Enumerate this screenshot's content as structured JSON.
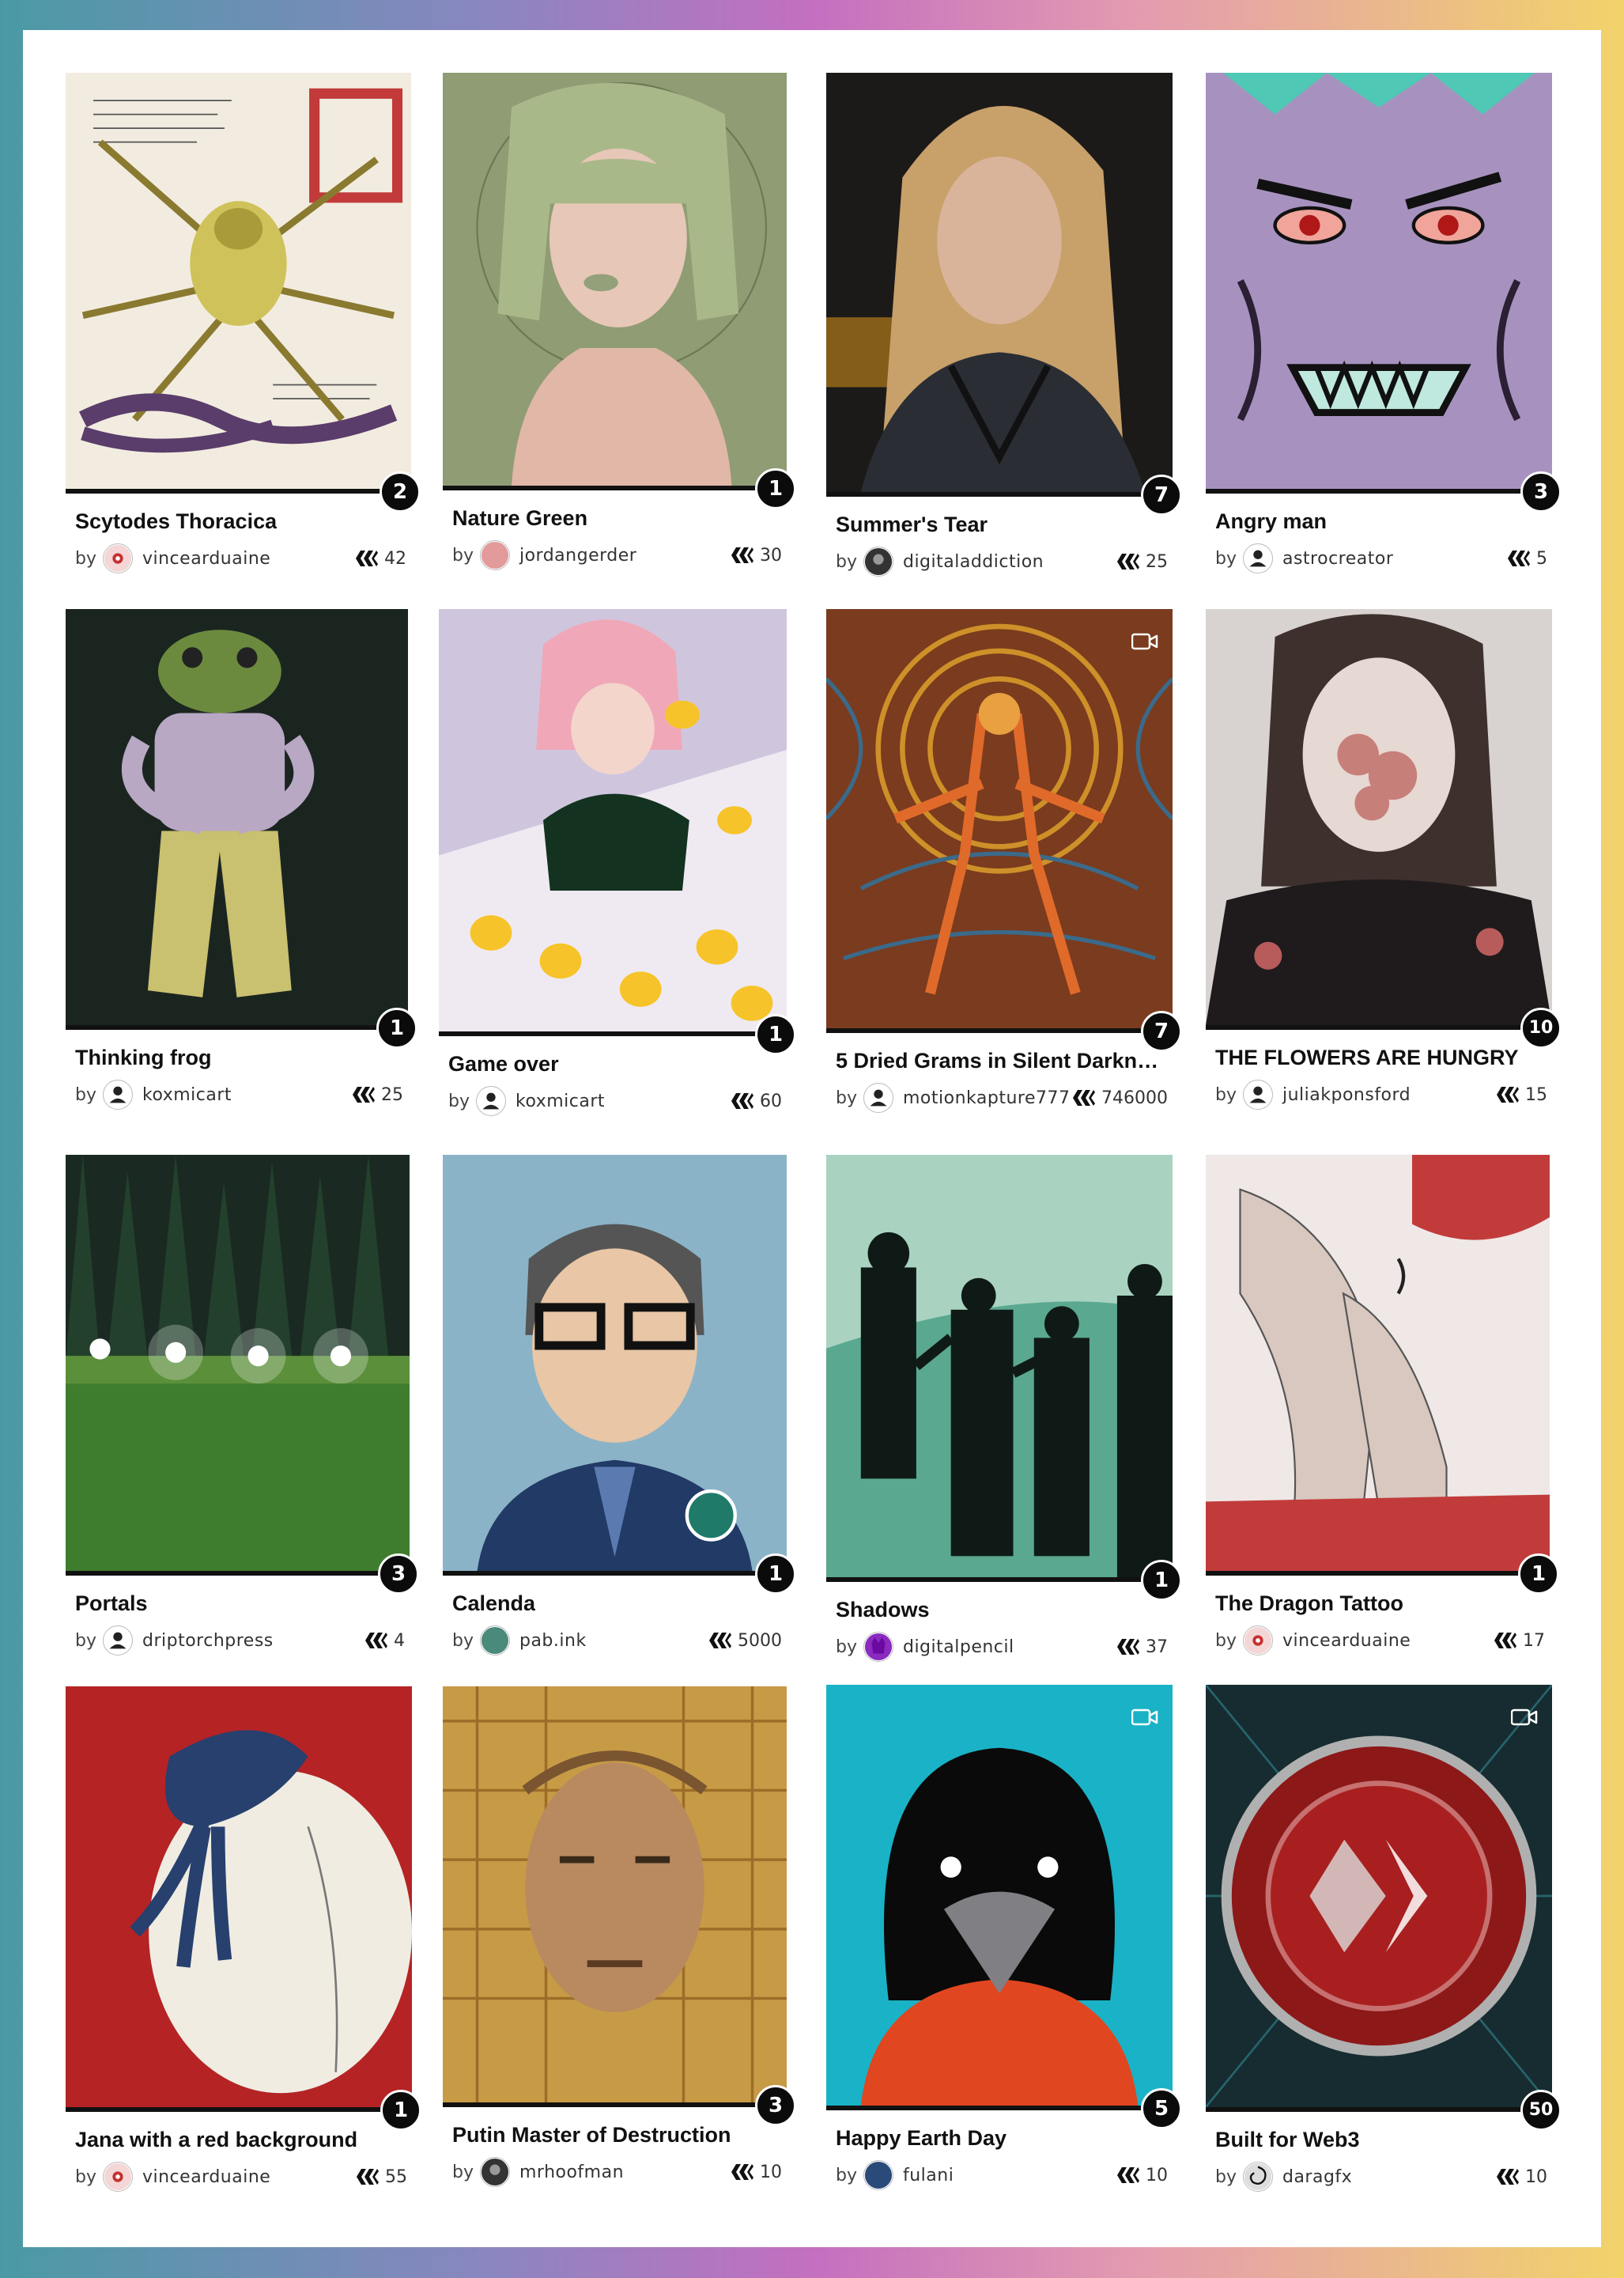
{
  "colors": {
    "accent_border": "#111111",
    "badge_bg": "#0b0b0b"
  },
  "cards": [
    {
      "title": "Scytodes Thoracica",
      "by": "by",
      "author": "vincearduaine",
      "avatar": "seal-avatar",
      "badge": "2",
      "count": "42",
      "video": false
    },
    {
      "title": "Nature Green",
      "by": "by",
      "author": "jordangerder",
      "avatar": "pink-avatar",
      "badge": "1",
      "count": "30",
      "video": false
    },
    {
      "title": "Summer's Tear",
      "by": "by",
      "author": "digitaladdiction",
      "avatar": "dark-avatar",
      "badge": "7",
      "count": "25",
      "video": false
    },
    {
      "title": "Angry man",
      "by": "by",
      "author": "astrocreator",
      "avatar": "default-user-icon",
      "badge": "3",
      "count": "5",
      "video": false
    },
    {
      "title": "Thinking frog",
      "by": "by",
      "author": "koxmicart",
      "avatar": "default-user-icon",
      "badge": "1",
      "count": "25",
      "video": false
    },
    {
      "title": "Game over",
      "by": "by",
      "author": "koxmicart",
      "avatar": "default-user-icon",
      "badge": "1",
      "count": "60",
      "video": false
    },
    {
      "title": "5 Dried Grams in Silent Darkne…",
      "by": "by",
      "author": "motionkapture777",
      "avatar": "default-user-icon",
      "badge": "7",
      "count": "746000",
      "video": true
    },
    {
      "title": "THE FLOWERS ARE HUNGRY",
      "by": "by",
      "author": "juliakponsford",
      "avatar": "default-user-icon",
      "badge": "10",
      "count": "15",
      "video": false
    },
    {
      "title": "Portals",
      "by": "by",
      "author": "driptorchpress",
      "avatar": "default-user-icon",
      "badge": "3",
      "count": "4",
      "video": false
    },
    {
      "title": "Calenda",
      "by": "by",
      "author": "pab.ink",
      "avatar": "green-avatar",
      "badge": "1",
      "count": "5000",
      "video": false
    },
    {
      "title": "Shadows",
      "by": "by",
      "author": "digitalpencil",
      "avatar": "purple-avatar",
      "badge": "1",
      "count": "37",
      "video": false
    },
    {
      "title": "The Dragon Tattoo",
      "by": "by",
      "author": "vincearduaine",
      "avatar": "seal-avatar",
      "badge": "1",
      "count": "17",
      "video": false
    },
    {
      "title": "Jana with a red background",
      "by": "by",
      "author": "vincearduaine",
      "avatar": "seal-avatar",
      "badge": "1",
      "count": "55",
      "video": false
    },
    {
      "title": "Putin Master of Destruction",
      "by": "by",
      "author": "mrhoofman",
      "avatar": "dark-avatar",
      "badge": "3",
      "count": "10",
      "video": false
    },
    {
      "title": "Happy Earth Day",
      "by": "by",
      "author": "fulani",
      "avatar": "blue-avatar",
      "badge": "5",
      "count": "10",
      "video": true
    },
    {
      "title": "Built for Web3",
      "by": "by",
      "author": "daragfx",
      "avatar": "swirl-avatar",
      "badge": "50",
      "count": "10",
      "video": true
    }
  ]
}
